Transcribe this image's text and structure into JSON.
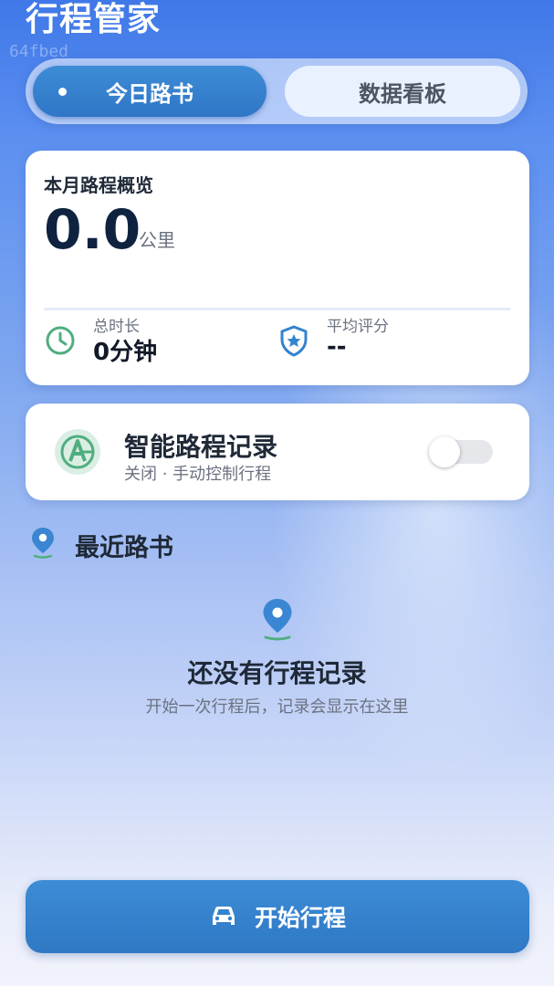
{
  "app": {
    "title": "行程管家",
    "watermark": "64fbed"
  },
  "tabs": [
    {
      "label": "今日路书",
      "active": true
    },
    {
      "label": "数据看板",
      "active": false
    }
  ],
  "overview": {
    "title": "本月路程概览",
    "distance": "0.0",
    "distance_unit": "公里",
    "duration_label": "总时长",
    "duration_value": "0分钟",
    "rating_label": "平均评分",
    "rating_value": "--"
  },
  "smart_record": {
    "title": "智能路程记录",
    "subtitle": "关闭 · 手动控制行程",
    "enabled": false
  },
  "recent": {
    "title": "最近路书",
    "empty_title": "还没有行程记录",
    "empty_subtitle": "开始一次行程后，记录会显示在这里"
  },
  "start_button": {
    "label": "开始行程"
  },
  "colors": {
    "accent": "#3383cf",
    "green": "#4fae7f",
    "text_dark": "#1f2937"
  },
  "icons": [
    "clock-icon",
    "shield-star-icon",
    "auto-record-icon",
    "location-pin-icon",
    "car-icon"
  ]
}
